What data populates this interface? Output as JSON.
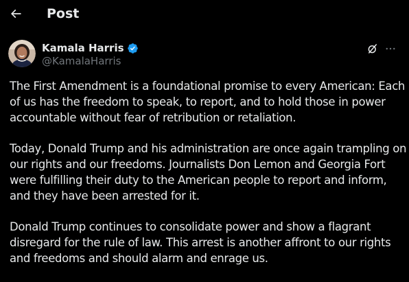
{
  "header": {
    "title": "Post",
    "back_icon": "arrow-left-icon"
  },
  "author": {
    "name": "Kamala Harris",
    "handle": "@KamalaHarris",
    "verified": true,
    "verified_color": "#1d9bf0"
  },
  "actions": {
    "grok_icon": "grok-icon",
    "more_icon": "more-horizontal-icon"
  },
  "tweet": {
    "paragraphs": [
      [
        "The First Amendment is a foundational promise to every American: Each",
        "of us has the freedom to speak, to report, and to hold those in power",
        "accountable without fear of retribution or retaliation."
      ],
      [
        "Today, Donald Trump and his administration are once again trampling on",
        "our rights and our freedoms. Journalists Don Lemon and Georgia Fort",
        "were fulfilling their duty to the American people to report and inform,",
        "and they have been arrested for it."
      ],
      [
        "Donald Trump continues to consolidate power and show a flagrant",
        "disregard for the rule of law. This arrest is another affront to our rights",
        "and freedoms and should alarm and enrage us."
      ]
    ]
  },
  "colors": {
    "background": "#000000",
    "text_primary": "#e7e9ea",
    "text_secondary": "#71767b",
    "accent": "#1d9bf0"
  }
}
